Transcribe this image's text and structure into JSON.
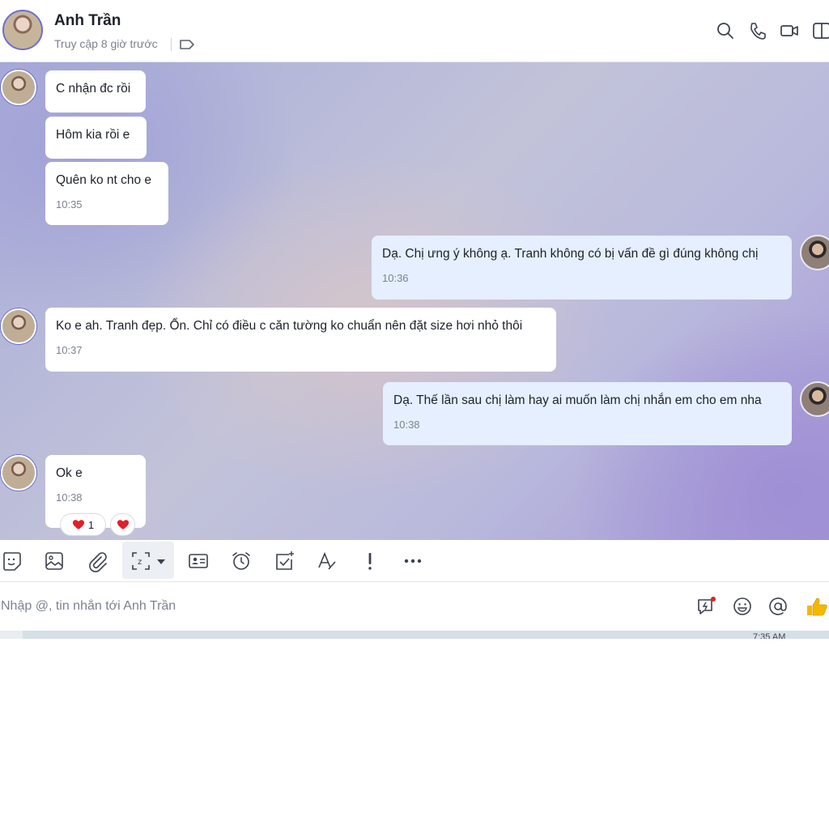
{
  "header": {
    "contact_name": "Anh Trần",
    "last_seen": "Truy cập 8 giờ trước"
  },
  "messages": [
    {
      "direction": "in",
      "text": "C nhận đc rồi"
    },
    {
      "direction": "in",
      "text": "Hôm kia rồi e"
    },
    {
      "direction": "in",
      "text": "Quên ko nt cho e",
      "time": "10:35"
    },
    {
      "direction": "out",
      "text": "Dạ. Chị ưng ý không ạ. Tranh không có bị vấn đề gì đúng không chị",
      "time": "10:36"
    },
    {
      "direction": "in",
      "text": "Ko e ah. Tranh đẹp. Ổn. Chỉ có điều c căn tường ko chuẩn nên đặt size hơi nhỏ thôi",
      "time": "10:37"
    },
    {
      "direction": "out",
      "text": "Dạ. Thế lần sau chị làm hay ai muốn làm chị nhắn em cho em nha",
      "time": "10:38"
    },
    {
      "direction": "in",
      "text": "Ok e",
      "time": "10:38",
      "reaction_count": "1"
    }
  ],
  "toolbar": {
    "icons": [
      "sticker-icon",
      "image-icon",
      "attachment-icon",
      "screenshot-icon",
      "contact-card-icon",
      "reminder-icon",
      "task-icon",
      "text-format-icon",
      "urgent-icon",
      "more-icon"
    ]
  },
  "composer": {
    "placeholder": "Nhập @, tin nhắn tới Anh Trần"
  },
  "taskbar": {
    "time_partial": "7:35 AM"
  },
  "colors": {
    "accent": "#0068ff",
    "outgoing_bubble": "#e5efff",
    "incoming_bubble": "#ffffff",
    "like": "#f5b800",
    "heart": "#e0202a"
  }
}
